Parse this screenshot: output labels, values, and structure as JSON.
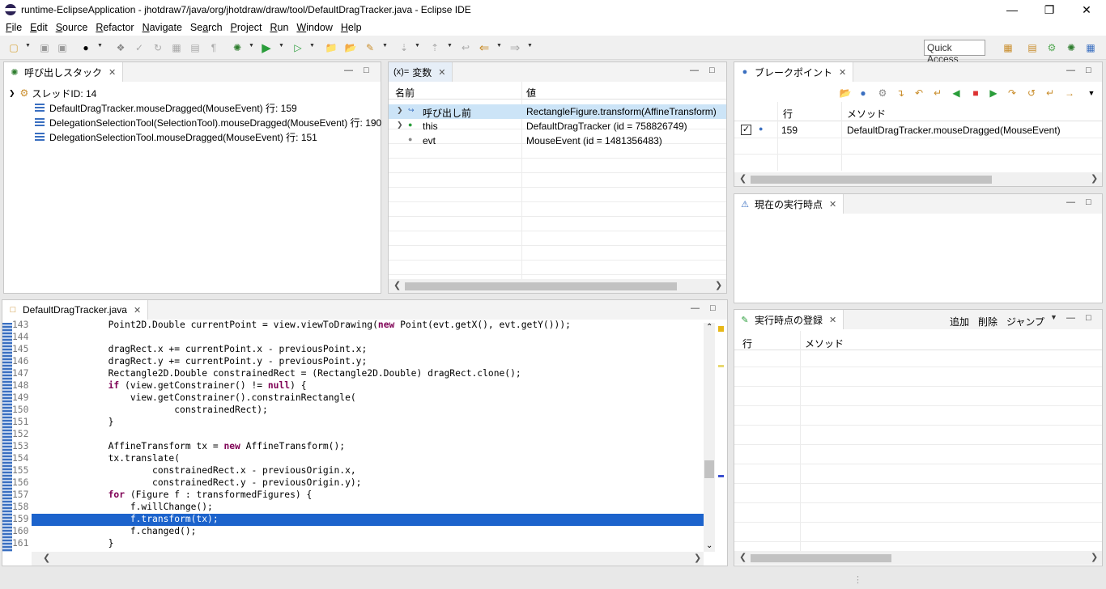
{
  "window": {
    "title": "runtime-EclipseApplication - jhotdraw7/java/org/jhotdraw/draw/tool/DefaultDragTracker.java - Eclipse IDE"
  },
  "menu": [
    {
      "label": "File",
      "u": "F",
      "rest": "ile"
    },
    {
      "label": "Edit",
      "u": "E",
      "rest": "dit"
    },
    {
      "label": "Source",
      "u": "S",
      "rest": "ource"
    },
    {
      "label": "Refactor",
      "u": "R",
      "rest": "efactor"
    },
    {
      "label": "Navigate",
      "u": "N",
      "rest": "avigate"
    },
    {
      "label": "Search",
      "u": "a",
      "pre": "Se",
      "rest": "rch"
    },
    {
      "label": "Project",
      "u": "P",
      "rest": "roject"
    },
    {
      "label": "Run",
      "u": "R",
      "rest": "un"
    },
    {
      "label": "Window",
      "u": "W",
      "rest": "indow"
    },
    {
      "label": "Help",
      "u": "H",
      "rest": "elp"
    }
  ],
  "toolbar": {
    "quick_access": "Quick Access"
  },
  "callstack": {
    "tab": "呼び出しスタック",
    "thread": "スレッドID: 14",
    "frames": [
      "DefaultDragTracker.mouseDragged(MouseEvent) 行: 159",
      "DelegationSelectionTool(SelectionTool).mouseDragged(MouseEvent) 行: 190",
      "DelegationSelectionTool.mouseDragged(MouseEvent) 行: 151"
    ]
  },
  "variables": {
    "tab": "変数",
    "tab_prefix": "(x)=",
    "col_name": "名前",
    "col_value": "値",
    "rows": [
      {
        "name": "呼び出し前",
        "value": "RectangleFigure.transform(AffineTransform)"
      },
      {
        "name": "this",
        "value": "DefaultDragTracker (id = 758826749)"
      },
      {
        "name": "evt",
        "value": "MouseEvent (id = 1481356483)"
      }
    ]
  },
  "breakpoints": {
    "tab": "ブレークポイント",
    "col_line": "行",
    "col_method": "メソッド",
    "rows": [
      {
        "line": "159",
        "method": "DefaultDragTracker.mouseDragged(MouseEvent)"
      }
    ]
  },
  "current_point": {
    "tab": "現在の実行時点"
  },
  "registration": {
    "tab": "実行時点の登録",
    "add": "追加",
    "delete": "削除",
    "jump": "ジャンプ",
    "col_line": "行",
    "col_method": "メソッド"
  },
  "editor": {
    "tab": "DefaultDragTracker.java",
    "lines": [
      {
        "n": "143",
        "code": "Point2D.Double currentPoint = view.viewToDrawing(new Point(evt.getX(), evt.getY()));"
      },
      {
        "n": "144",
        "code": ""
      },
      {
        "n": "145",
        "code": "dragRect.x += currentPoint.x - previousPoint.x;"
      },
      {
        "n": "146",
        "code": "dragRect.y += currentPoint.y - previousPoint.y;"
      },
      {
        "n": "147",
        "code": "Rectangle2D.Double constrainedRect = (Rectangle2D.Double) dragRect.clone();"
      },
      {
        "n": "148",
        "code": "if (view.getConstrainer() != null) {"
      },
      {
        "n": "149",
        "code": "    view.getConstrainer().constrainRectangle("
      },
      {
        "n": "150",
        "code": "            constrainedRect);"
      },
      {
        "n": "151",
        "code": "}"
      },
      {
        "n": "152",
        "code": ""
      },
      {
        "n": "153",
        "code": "AffineTransform tx = new AffineTransform();"
      },
      {
        "n": "154",
        "code": "tx.translate("
      },
      {
        "n": "155",
        "code": "        constrainedRect.x - previousOrigin.x,"
      },
      {
        "n": "156",
        "code": "        constrainedRect.y - previousOrigin.y);"
      },
      {
        "n": "157",
        "code": "for (Figure f : transformedFigures) {"
      },
      {
        "n": "158",
        "code": "    f.willChange();"
      },
      {
        "n": "159",
        "code": "    f.transform(tx);"
      },
      {
        "n": "160",
        "code": "    f.changed();"
      },
      {
        "n": "161",
        "code": "}"
      }
    ]
  }
}
